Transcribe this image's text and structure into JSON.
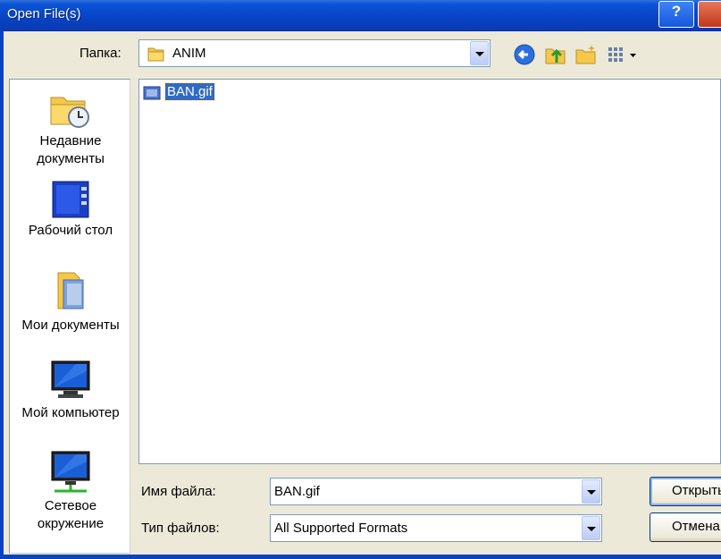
{
  "window": {
    "title": "Open File(s)",
    "help_label": "?"
  },
  "toolbar": {
    "folder_label": "Папка:",
    "folder_value": "ANIM",
    "back_icon": "back-arrow-icon",
    "up_icon": "up-folder-icon",
    "new_folder_icon": "new-folder-icon",
    "views_icon": "views-menu-icon"
  },
  "places": [
    {
      "label_line1": "Недавние",
      "label_line2": "документы",
      "icon": "recent-documents-icon"
    },
    {
      "label_line1": "Рабочий стол",
      "label_line2": "",
      "icon": "desktop-icon"
    },
    {
      "label_line1": "Мои документы",
      "label_line2": "",
      "icon": "my-documents-icon"
    },
    {
      "label_line1": "Мой компьютер",
      "label_line2": "",
      "icon": "my-computer-icon"
    },
    {
      "label_line1": "Сетевое",
      "label_line2": "окружение",
      "icon": "network-places-icon"
    }
  ],
  "files": [
    {
      "name": "BAN.gif",
      "icon": "gif-file-icon",
      "selected": true
    }
  ],
  "form": {
    "filename_label": "Имя файла:",
    "filename_value": "BAN.gif",
    "filetype_label": "Тип файлов:",
    "filetype_value": "All Supported Formats"
  },
  "buttons": {
    "open_label": "Открыть",
    "cancel_label": "Отмена"
  },
  "colors": {
    "titlebar": "#0843c4",
    "selection": "#316ac5",
    "dialog_bg": "#ece9d8"
  }
}
